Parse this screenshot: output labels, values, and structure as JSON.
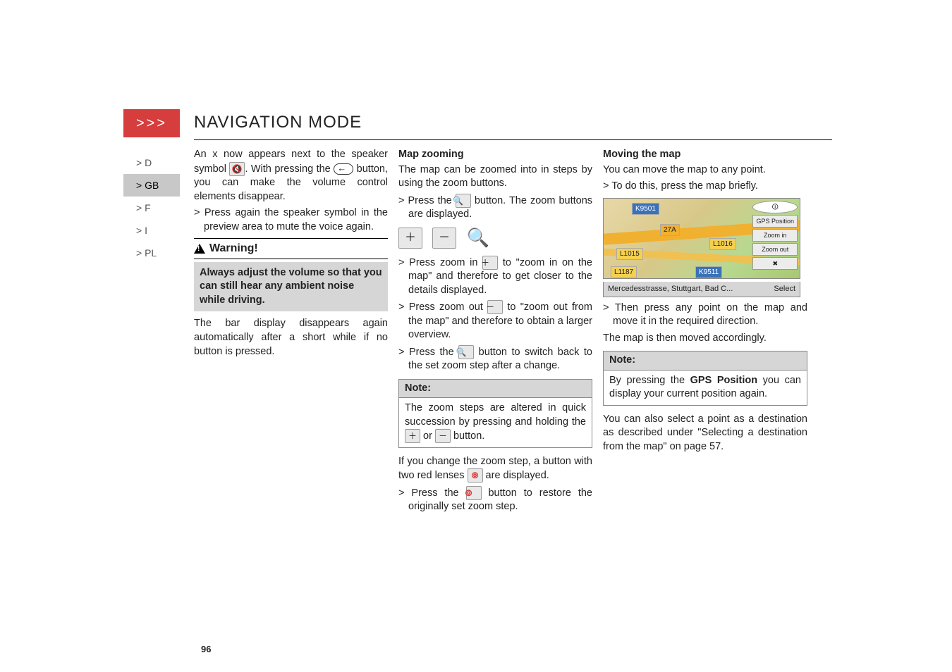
{
  "header": {
    "chevrons": ">>>",
    "title": "NAVIGATION MODE"
  },
  "sidenav": {
    "items": [
      "> D",
      "> GB",
      "> F",
      "> I",
      "> PL"
    ],
    "active_index": 1
  },
  "col1": {
    "p1a": "An x now appears next to the speaker symbol ",
    "p1b": ". With pressing the ",
    "p1c": " button, you can make the volume control elements disappear.",
    "li1": "> Press again the speaker symbol in the preview area to mute the voice again.",
    "warning_label": "Warning!",
    "warning_box": "Always adjust the volume so that you can still hear any ambient noise while driving.",
    "p2": "The bar display disappears again automatically after a short while if no button is pressed."
  },
  "col2": {
    "head": "Map zooming",
    "p1": "The map can be zoomed into in steps by using the zoom buttons.",
    "li1a": "> Press the ",
    "li1b": " button. The zoom buttons are displayed.",
    "li2a": "> Press zoom in ",
    "li2b": " to \"zoom in on the map\" and therefore to get closer to the details displayed.",
    "li3a": "> Press zoom out ",
    "li3b": " to \"zoom out from the map\" and therefore to obtain a larger overview.",
    "li4a": "> Press the ",
    "li4b": " button to switch back to the set zoom step after a change.",
    "note_label": "Note:",
    "note_body_a": "The zoom steps are altered in quick succession by pressing and holding the ",
    "note_body_b": " or ",
    "note_body_c": " button.",
    "p2a": "If you change the zoom step, a button with two red lenses ",
    "p2b": " are displayed.",
    "li5a": "> Press the ",
    "li5b": " button to restore the originally set zoom step."
  },
  "col3": {
    "head": "Moving the map",
    "p1": "You can move the map to any point.",
    "li1": "> To do this, press the map briefly.",
    "map": {
      "btn_gps": "GPS Position",
      "btn_zin": "Zoom in",
      "btn_zout": "Zoom out",
      "road1": "K9501",
      "road2": "27A",
      "road3": "L1015",
      "road4": "L1187",
      "road5": "K9511",
      "road6": "L1016",
      "footer_left": "Mercedesstrasse, Stuttgart, Bad C...",
      "footer_right": "Select"
    },
    "li2": "> Then press any point on the map and move it in the required direction.",
    "p2": "The map is then moved accordingly.",
    "note_label": "Note:",
    "note_body_a": "By pressing the ",
    "note_body_gps": "GPS Position",
    "note_body_b": " you can display your current position again.",
    "p3": "You can also select a point as a destination as described under \"Selecting a destination from the map\" on page 57."
  },
  "page_number": "96"
}
